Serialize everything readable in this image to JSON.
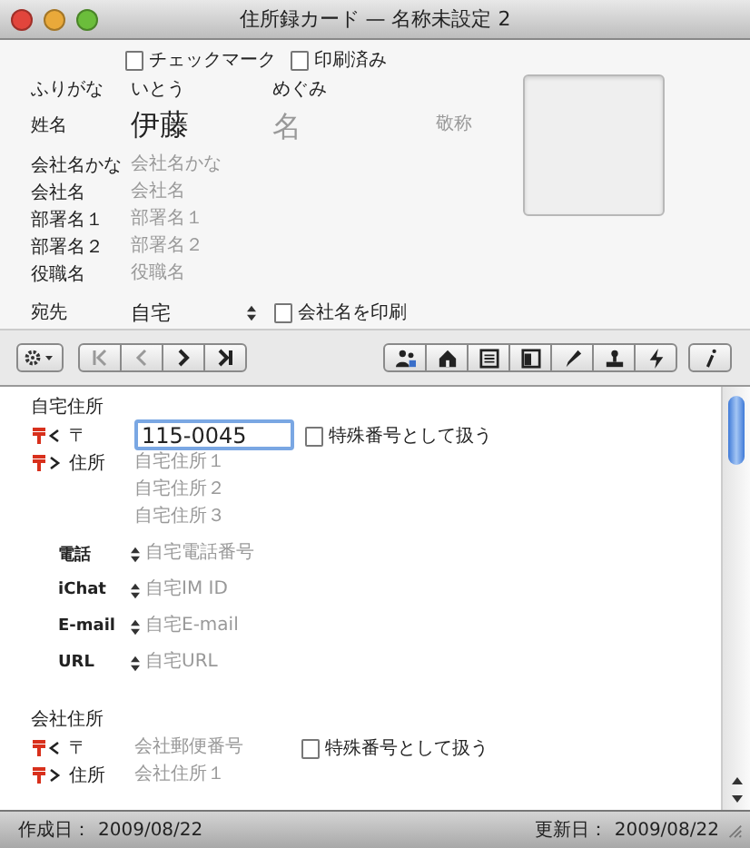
{
  "window": {
    "title": "住所録カード — 名称未設定 2"
  },
  "flags": [
    {
      "label": "チェックマーク",
      "checked": false
    },
    {
      "label": "印刷済み",
      "checked": false
    }
  ],
  "furigana": {
    "label": "ふりがな",
    "family": "いとう",
    "given": "めぐみ"
  },
  "name": {
    "label": "姓名",
    "family": "伊藤",
    "given_placeholder": "名",
    "honorific_placeholder": "敬称"
  },
  "company_fields": [
    {
      "label": "会社名かな",
      "placeholder": "会社名かな"
    },
    {
      "label": "会社名",
      "placeholder": "会社名"
    },
    {
      "label": "部署名１",
      "placeholder": "部署名１"
    },
    {
      "label": "部署名２",
      "placeholder": "部署名２"
    },
    {
      "label": "役職名",
      "placeholder": "役職名"
    }
  ],
  "destination": {
    "label": "宛先",
    "value": "自宅",
    "print_company": {
      "label": "会社名を印刷",
      "checked": false
    }
  },
  "home": {
    "title": "自宅住所",
    "postal": {
      "label": "〒",
      "value": "115-0045",
      "special": {
        "label": "特殊番号として扱う",
        "checked": false
      }
    },
    "address": {
      "label": "住所",
      "placeholders": [
        "自宅住所１",
        "自宅住所２",
        "自宅住所３"
      ]
    },
    "contacts": [
      {
        "label": "電話",
        "placeholder": "自宅電話番号"
      },
      {
        "label": "iChat",
        "placeholder": "自宅IM ID"
      },
      {
        "label": "E-mail",
        "placeholder": "自宅E-mail"
      },
      {
        "label": "URL",
        "placeholder": "自宅URL"
      }
    ]
  },
  "company": {
    "title": "会社住所",
    "postal": {
      "label": "〒",
      "placeholder": "会社郵便番号",
      "special": {
        "label": "特殊番号として扱う",
        "checked": false
      }
    },
    "address": {
      "label": "住所",
      "placeholders": [
        "会社住所１"
      ]
    }
  },
  "status_bar": {
    "created_label": "作成日：",
    "created": "2009/08/22",
    "updated_label": "更新日：",
    "updated": "2009/08/22"
  }
}
